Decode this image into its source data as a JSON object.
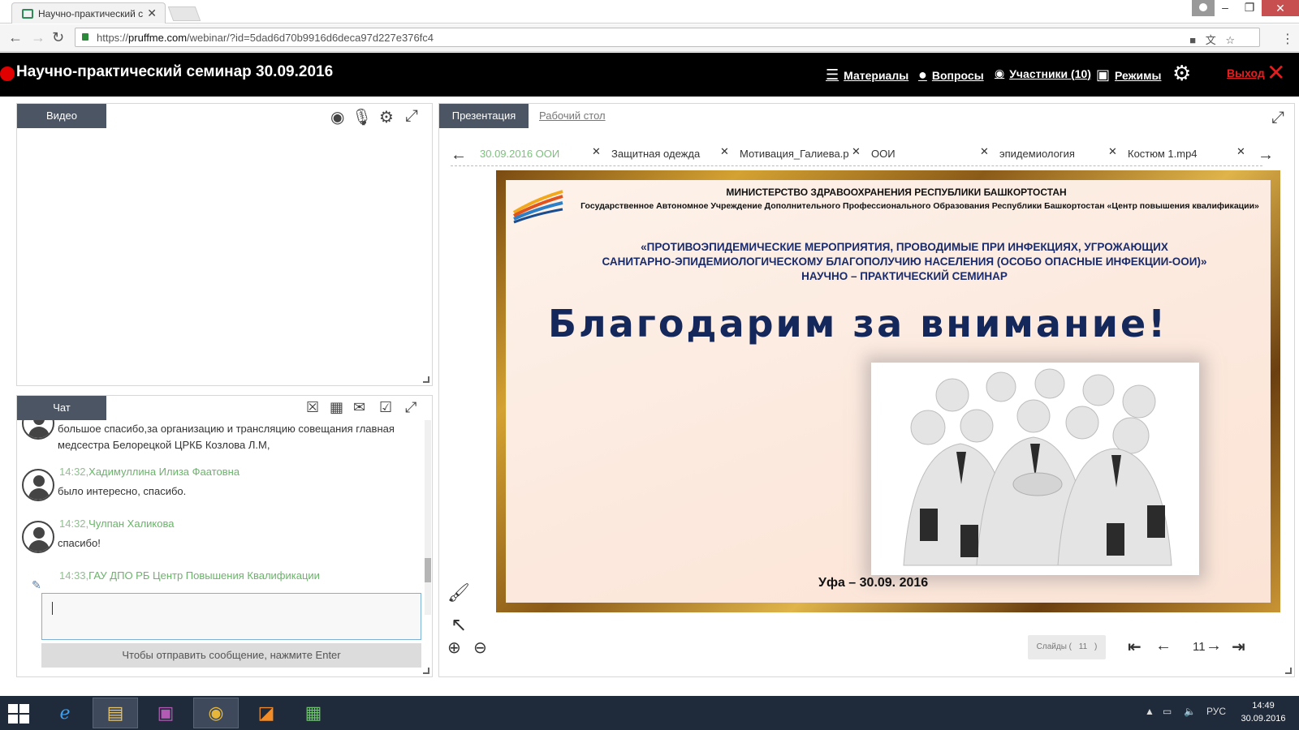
{
  "browser": {
    "tab_title": "Научно-практический с",
    "url_prefix": "https://",
    "url_host": "pruffme.com",
    "url_path": "/webinar/?id=5dad6d70b9916d6deca97d227e376fc4"
  },
  "header": {
    "title": "Научно-практический семинар 30.09.2016",
    "menu": {
      "materials": "Материалы",
      "questions": "Вопросы",
      "participants": "Участники (10)",
      "modes": "Режимы"
    },
    "exit": "Выход"
  },
  "video": {
    "tab_label": "Видео"
  },
  "chat": {
    "tab_label": "Чат",
    "messages": [
      {
        "time": "",
        "author": "",
        "text": "большое спасибо,за организацию и трансляцию совещания главная медсестра Белорецкой ЦРКБ Козлова Л.М,"
      },
      {
        "time": "14:32,",
        "author": "Хадимуллина Илиза Фаатовна",
        "text": "было интересно, спасибо."
      },
      {
        "time": "14:32,",
        "author": "Чулпан Халикова",
        "text": "спасибо!"
      },
      {
        "time": "14:33,",
        "author": "ГАУ ДПО РБ Центр Повышения Квалификации",
        "text": ""
      }
    ],
    "input_value": "",
    "send_hint": "Чтобы отправить сообщение, нажмите Enter"
  },
  "presentation": {
    "tab_active": "Презентация",
    "tab_desktop": "Рабочий стол",
    "files": [
      {
        "label": "30.09.2016 ООИ",
        "active": true
      },
      {
        "label": "Защитная одежда",
        "active": false
      },
      {
        "label": "Мотивация_Галиева.р",
        "active": false
      },
      {
        "label": "ООИ",
        "active": false
      },
      {
        "label": "эпидемиология",
        "active": false
      },
      {
        "label": "Костюм 1.mp4",
        "active": false
      }
    ],
    "slide": {
      "ministry": "МИНИСТЕРСТВО ЗДРАВООХРАНЕНИЯ РЕСПУБЛИКИ БАШКОРТОСТАН",
      "org": "Государственное Автономное Учреждение Дополнительного Профессионального Образования Республики Башкортостан «Центр повышения квалификации»",
      "theme_line1": "«ПРОТИВОЭПИДЕМИЧЕСКИЕ МЕРОПРИЯТИЯ, ПРОВОДИМЫЕ ПРИ ИНФЕКЦИЯХ, УГРОЖАЮЩИХ",
      "theme_line2": "САНИТАРНО-ЭПИДЕМИОЛОГИЧЕСКОМУ БЛАГОПОЛУЧИЮ НАСЕЛЕНИЯ (ОСОБО ОПАСНЫЕ ИНФЕКЦИИ-ООИ)»",
      "theme_line3": "НАУЧНО – ПРАКТИЧЕСКИЙ СЕМИНАР",
      "thanks": "Благодарим за внимание!",
      "footer": "Уфа – 30.09. 2016"
    },
    "slides_label": "Слайды (",
    "slides_total": "11",
    "slides_close": ")",
    "current_slide": "11"
  },
  "taskbar": {
    "lang": "РУС",
    "time": "14:49",
    "date": "30.09.2016"
  },
  "colors": {
    "header_bg": "#000000",
    "tab_bg": "#4b5563",
    "accent_green": "#6bb36b",
    "exit_red": "#e02020"
  }
}
